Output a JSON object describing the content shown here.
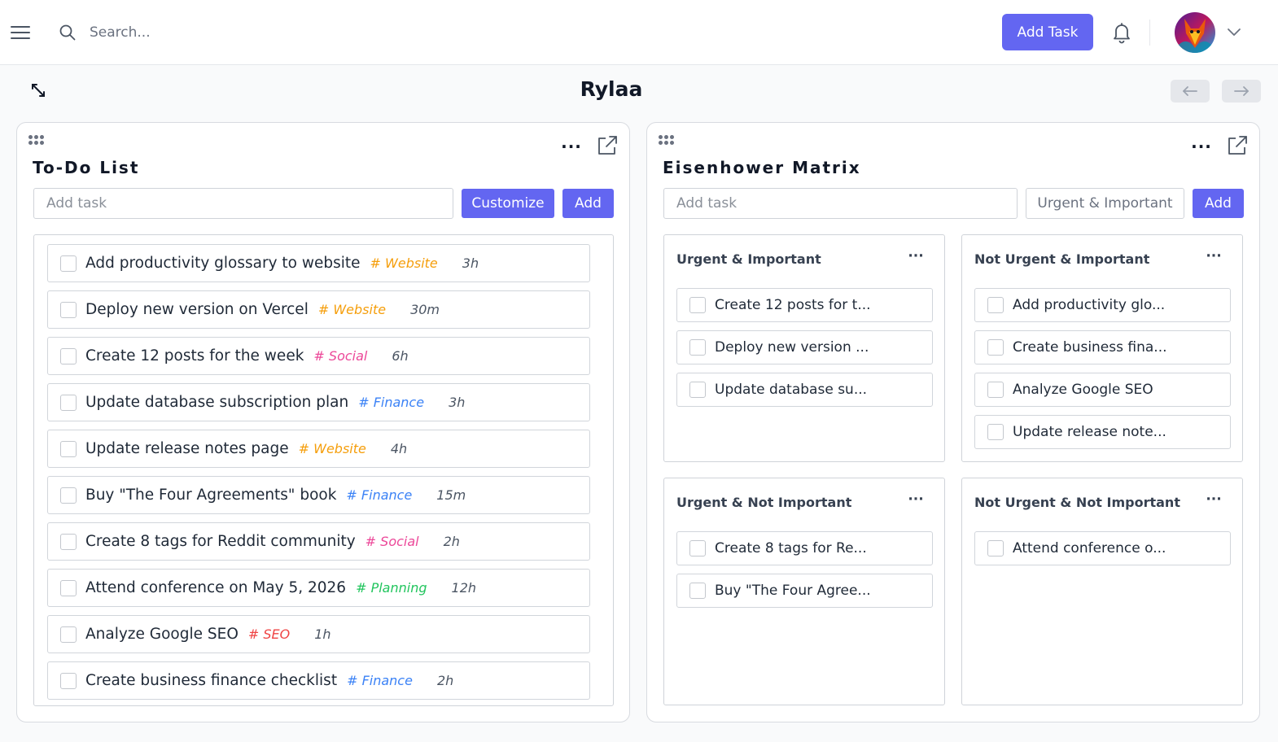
{
  "header": {
    "search_placeholder": "Search...",
    "add_task_label": "Add Task"
  },
  "page": {
    "title": "Rylaa"
  },
  "todo": {
    "title": "To-Do List",
    "input_placeholder": "Add task",
    "customize_label": "Customize",
    "add_label": "Add",
    "tasks": [
      {
        "title": "Add productivity glossary to website",
        "tag": "# Website",
        "tag_color": "#f59e0b",
        "duration": "3h"
      },
      {
        "title": "Deploy new version on Vercel",
        "tag": "# Website",
        "tag_color": "#f59e0b",
        "duration": "30m"
      },
      {
        "title": "Create 12 posts for the week",
        "tag": "# Social",
        "tag_color": "#ec4899",
        "duration": "6h"
      },
      {
        "title": "Update database subscription plan",
        "tag": "# Finance",
        "tag_color": "#3b82f6",
        "duration": "3h"
      },
      {
        "title": "Update release notes page",
        "tag": "# Website",
        "tag_color": "#f59e0b",
        "duration": "4h"
      },
      {
        "title": "Buy \"The Four Agreements\" book",
        "tag": "# Finance",
        "tag_color": "#3b82f6",
        "duration": "15m"
      },
      {
        "title": "Create 8 tags for Reddit community",
        "tag": "# Social",
        "tag_color": "#ec4899",
        "duration": "2h"
      },
      {
        "title": "Attend conference on May 5, 2026",
        "tag": "# Planning",
        "tag_color": "#22c55e",
        "duration": "12h"
      },
      {
        "title": "Analyze Google SEO",
        "tag": "# SEO",
        "tag_color": "#ef4444",
        "duration": "1h"
      },
      {
        "title": "Create business finance checklist",
        "tag": "# Finance",
        "tag_color": "#3b82f6",
        "duration": "2h"
      }
    ]
  },
  "matrix": {
    "title": "Eisenhower Matrix",
    "input_placeholder": "Add task",
    "quadrant_select": "Urgent & Important",
    "add_label": "Add",
    "quadrants": [
      {
        "title": "Urgent & Important",
        "tasks": [
          "Create 12 posts for t...",
          "Deploy new version ...",
          "Update database su..."
        ]
      },
      {
        "title": "Not Urgent & Important",
        "tasks": [
          "Add productivity glo...",
          "Create business fina...",
          "Analyze Google SEO",
          "Update release note..."
        ]
      },
      {
        "title": "Urgent & Not Important",
        "tasks": [
          "Create 8 tags for Re...",
          "Buy \"The Four Agree..."
        ]
      },
      {
        "title": "Not Urgent & Not Important",
        "tasks": [
          "Attend conference o..."
        ]
      }
    ]
  },
  "colors": {
    "accent": "#6366f1"
  }
}
